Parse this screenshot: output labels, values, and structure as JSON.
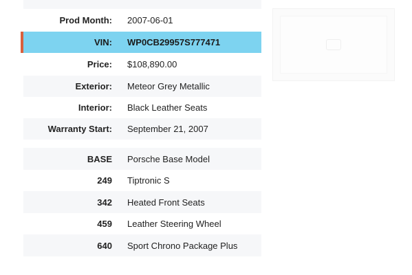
{
  "specs": [
    {
      "label": "Prod Month:",
      "value": "2007-06-01"
    },
    {
      "label": "VIN:",
      "value": "WP0CB29957S777471"
    },
    {
      "label": "Price:",
      "value": "$108,890.00"
    },
    {
      "label": "Exterior:",
      "value": "Meteor Grey Metallic"
    },
    {
      "label": "Interior:",
      "value": "Black Leather Seats"
    },
    {
      "label": "Warranty Start:",
      "value": "September 21, 2007"
    }
  ],
  "options": [
    {
      "code": "BASE",
      "description": "Porsche Base Model"
    },
    {
      "code": "249",
      "description": "Tiptronic S"
    },
    {
      "code": "342",
      "description": "Heated Front Seats"
    },
    {
      "code": "459",
      "description": "Leather Steering Wheel"
    },
    {
      "code": "640",
      "description": "Sport Chrono Package Plus"
    }
  ],
  "colors": {
    "highlight": "#7dd3f0",
    "accent": "#d9603d",
    "row_alt": "#f6f7f9"
  },
  "icons": {
    "photo": "image-placeholder-icon"
  }
}
